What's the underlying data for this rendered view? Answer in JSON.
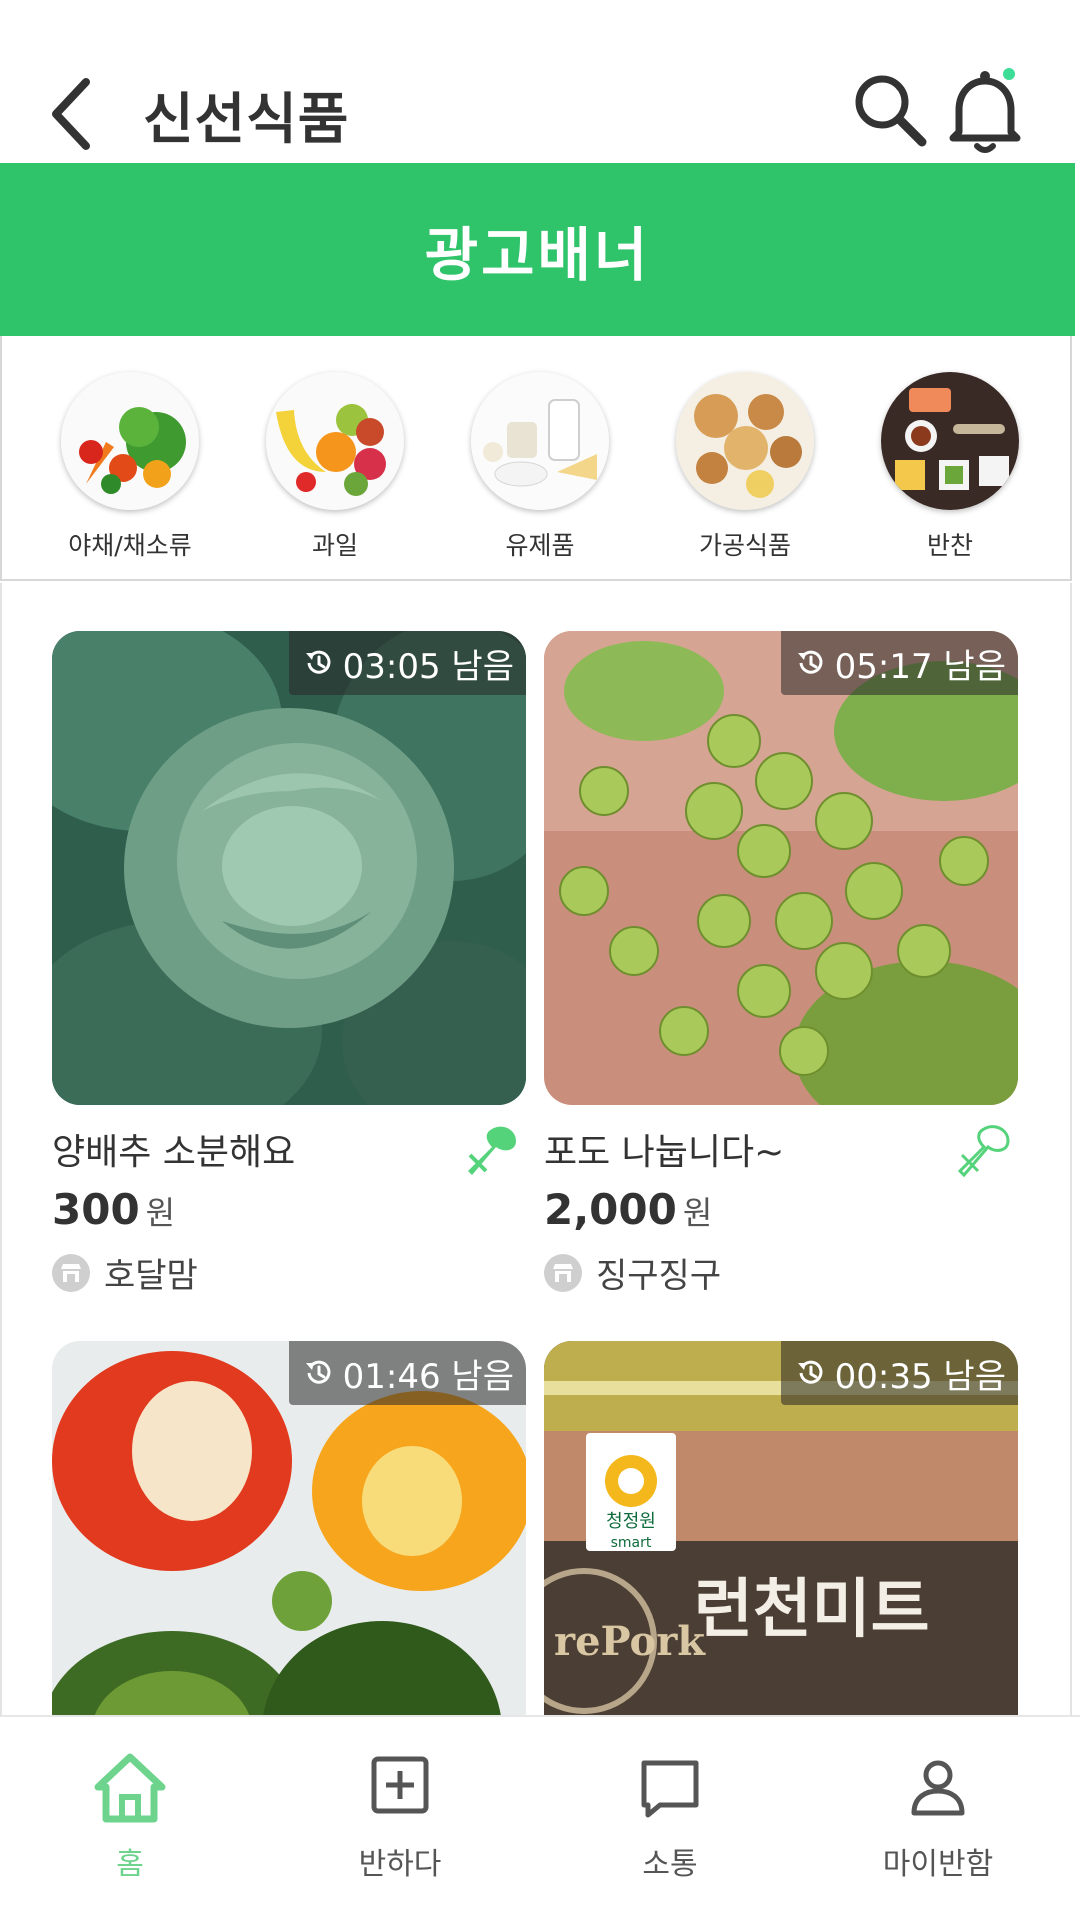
{
  "header": {
    "title": "신선식품",
    "back_icon": "chevron-left-icon",
    "search_icon": "search-icon",
    "bell_icon": "bell-icon",
    "notification_dot_color": "#3ddc97"
  },
  "ad_banner": {
    "text": "광고배너",
    "color": "#2fc36a"
  },
  "categories": [
    {
      "label": "야채/채소류"
    },
    {
      "label": "과일"
    },
    {
      "label": "유제품"
    },
    {
      "label": "가공식품"
    },
    {
      "label": "반찬"
    }
  ],
  "products": [
    {
      "timer": "03:05 남음",
      "title": "양배추 소분해요",
      "price": "300",
      "currency": "원",
      "seller": "호달맘",
      "utensil_state": "filled"
    },
    {
      "timer": "05:17 남음",
      "title": "포도 나눕니다~",
      "price": "2,000",
      "currency": "원",
      "seller": "징구징구",
      "utensil_state": "outline"
    },
    {
      "timer": "01:46 남음"
    },
    {
      "timer": "00:35 남음",
      "package_brand": "청정원",
      "package_brand_sub": "smart",
      "package_name": "런천미트",
      "package_badge": "rePork"
    }
  ],
  "bottom_nav": [
    {
      "label": "홈",
      "icon": "home-icon",
      "active": true
    },
    {
      "label": "반하다",
      "icon": "plus-square-icon",
      "active": false
    },
    {
      "label": "소통",
      "icon": "chat-icon",
      "active": false
    },
    {
      "label": "마이반함",
      "icon": "person-icon",
      "active": false
    }
  ],
  "colors": {
    "accent": "#2fc36a",
    "active_nav": "#6ed48d",
    "text": "#333333"
  }
}
